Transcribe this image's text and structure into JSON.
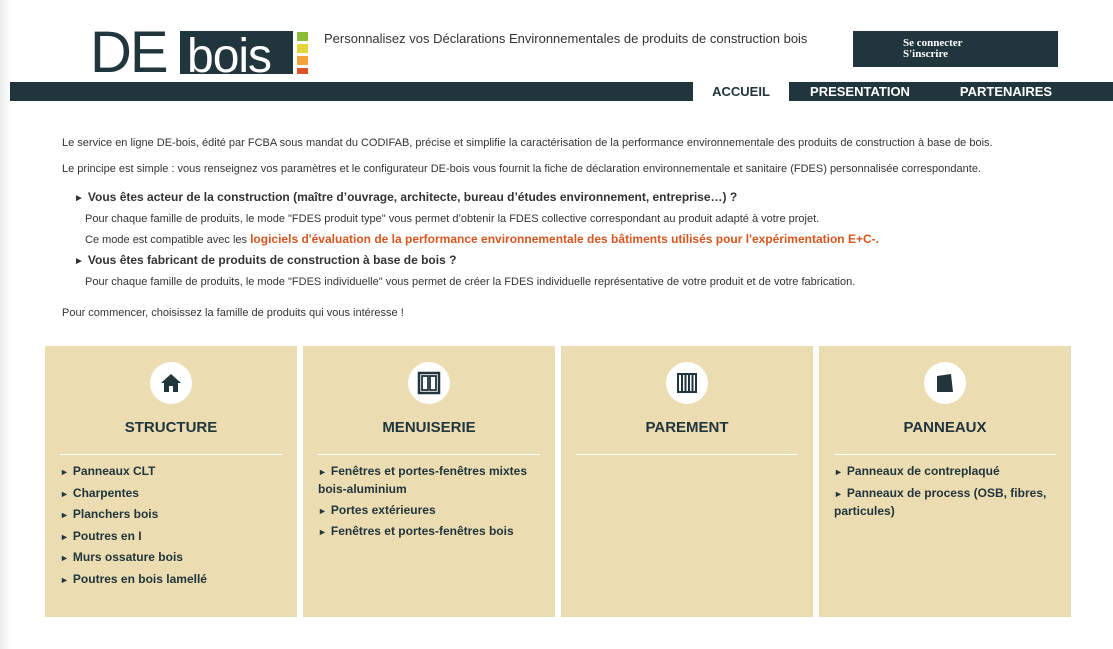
{
  "header": {
    "logo_text": "DEbois",
    "tagline": "Personnalisez vos Déclarations Environnementales de produits de construction bois",
    "login": "Se connecter",
    "register": "S'inscrire"
  },
  "nav": {
    "tabs": [
      {
        "label": "ACCUEIL",
        "active": true
      },
      {
        "label": "PRESENTATION",
        "active": false
      },
      {
        "label": "PARTENAIRES",
        "active": false
      }
    ]
  },
  "intro": {
    "p1": "Le service en ligne DE-bois, édité par FCBA sous mandat du CODIFAB, précise et simplifie la caractérisation de la performance environnementale des produits de construction à base de bois.",
    "p2": "Le principe est simple : vous renseignez vos paramètres et le configurateur DE-bois vous fournit la fiche de déclaration environnementale et sanitaire (FDES) personnalisée correspondante.",
    "q1": "Vous êtes acteur de la construction (maître d’ouvrage, architecte, bureau d’études environnement, entreprise…) ?",
    "q1_line1": "Pour chaque famille de produits, le mode \"FDES produit type\" vous permet d’obtenir la FDES collective correspondant au produit adapté à votre projet.",
    "q1_line2_prefix": "Ce mode est compatible avec les ",
    "q1_line2_link": "logiciels d'évaluation de la performance environnementale des bâtiments utilisés pour l'expérimentation E+C-.",
    "q2": "Vous êtes fabricant de produits de construction à base de bois ?",
    "q2_line1": "Pour chaque famille de produits, le mode \"FDES individuelle\" vous permet de créer la FDES individuelle représentative de votre produit et de votre fabrication.",
    "start": "Pour commencer, choisissez la famille de produits qui vous intéresse !"
  },
  "cards": [
    {
      "title": "STRUCTURE",
      "icon": "house-icon",
      "items": [
        "Panneaux CLT",
        "Charpentes",
        "Planchers bois",
        "Poutres en I",
        "Murs ossature bois",
        "Poutres en bois lamellé"
      ]
    },
    {
      "title": "MENUISERIE",
      "icon": "window-icon",
      "items": [
        "Fenêtres et portes-fenêtres mixtes bois-aluminium",
        "Portes extérieures",
        "Fenêtres et portes-fenêtres bois"
      ]
    },
    {
      "title": "PAREMENT",
      "icon": "cladding-icon",
      "items": []
    },
    {
      "title": "PANNEAUX",
      "icon": "panel-icon",
      "items": [
        "Panneaux de contreplaqué",
        "Panneaux de process (OSB, fibres, particules)"
      ]
    }
  ],
  "colors": {
    "dark": "#21353c",
    "card_bg": "#ecdcb2",
    "link_orange": "#d6561f"
  }
}
